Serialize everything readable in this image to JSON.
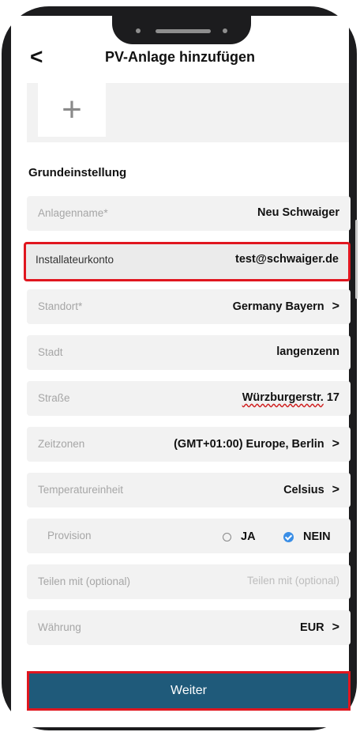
{
  "header": {
    "back_icon": "chevron-left-icon",
    "title": "PV-Anlage hinzufügen"
  },
  "photo": {
    "add_icon": "plus-icon"
  },
  "section": {
    "title": "Grundeinstellung"
  },
  "fields": {
    "name": {
      "label": "Anlagenname*",
      "value": "Neu Schwaiger"
    },
    "installer": {
      "label": "Installateurkonto",
      "value": "test@schwaiger.de"
    },
    "location": {
      "label": "Standort*",
      "value": "Germany Bayern"
    },
    "city": {
      "label": "Stadt",
      "value": "langenzenn"
    },
    "street": {
      "label": "Straße",
      "value_main": "Würzburgerstr.",
      "value_num": " 17"
    },
    "timezone": {
      "label": "Zeitzonen",
      "value": "(GMT+01:00) Europe, Berlin"
    },
    "temperature": {
      "label": "Temperatureinheit",
      "value": "Celsius"
    },
    "provision": {
      "label": "Provision",
      "option_yes": "JA",
      "option_no": "NEIN",
      "selected": "NEIN"
    },
    "share": {
      "label": "Teilen mit (optional)",
      "placeholder": "Teilen mit (optional)"
    },
    "currency": {
      "label": "Währung",
      "value": "EUR"
    }
  },
  "chevron": ">",
  "back": "<",
  "plus": "+",
  "footer": {
    "button_label": "Weiter"
  },
  "colors": {
    "highlight": "#e0161f",
    "primary_button": "#1f5a7a",
    "radio_selected": "#3a8ee6"
  }
}
